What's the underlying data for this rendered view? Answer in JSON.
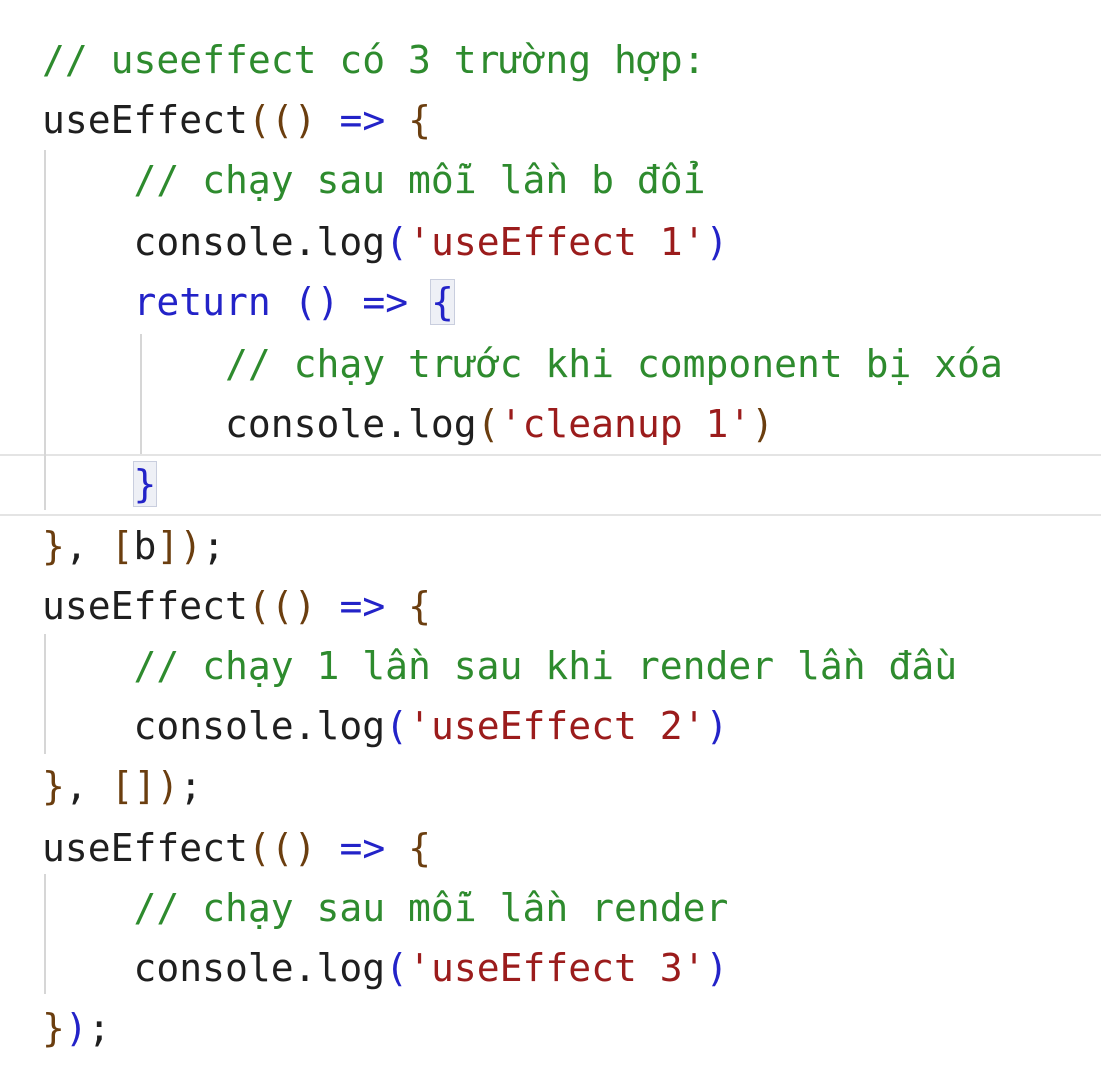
{
  "colors": {
    "comment": "#2e8b2e",
    "keyword": "#2323c8",
    "string": "#9b1c1c",
    "bracket_outer": "#6b3e0f",
    "bracket_mid": "#2323c8",
    "plain": "#1f1f1f",
    "indent_guide": "#d6d6d6",
    "current_line_border": "#e4e4e4"
  },
  "code": {
    "lines": [
      [
        {
          "t": "// useeffect có 3 trường hợp:",
          "c": "comment"
        }
      ],
      [
        {
          "t": "useEffect",
          "c": "plain"
        },
        {
          "t": "(",
          "c": "bracket_outer"
        },
        {
          "t": "()",
          "c": "bracket_outer"
        },
        {
          "t": " ",
          "c": "plain"
        },
        {
          "t": "=>",
          "c": "keyword"
        },
        {
          "t": " ",
          "c": "plain"
        },
        {
          "t": "{",
          "c": "bracket_outer"
        }
      ],
      [
        {
          "t": "    ",
          "c": "plain"
        },
        {
          "t": "// chạy sau mỗi lần b đổi",
          "c": "comment"
        }
      ],
      [
        {
          "t": "    console.log",
          "c": "plain"
        },
        {
          "t": "(",
          "c": "keyword"
        },
        {
          "t": "'useEffect 1'",
          "c": "string"
        },
        {
          "t": ")",
          "c": "keyword"
        }
      ],
      [
        {
          "t": "    ",
          "c": "plain"
        },
        {
          "t": "return",
          "c": "keyword"
        },
        {
          "t": " ",
          "c": "plain"
        },
        {
          "t": "()",
          "c": "keyword"
        },
        {
          "t": " => ",
          "c": "keyword"
        },
        {
          "t": "{",
          "c": "keyword",
          "hl": true
        }
      ],
      [
        {
          "t": "        ",
          "c": "plain"
        },
        {
          "t": "// chạy trước khi component bị xóa",
          "c": "comment"
        }
      ],
      [
        {
          "t": "        console.log",
          "c": "plain"
        },
        {
          "t": "(",
          "c": "bracket_outer"
        },
        {
          "t": "'cleanup 1'",
          "c": "string"
        },
        {
          "t": ")",
          "c": "bracket_outer"
        }
      ],
      [
        {
          "t": "    ",
          "c": "plain"
        },
        {
          "t": "}",
          "c": "keyword",
          "hl": true
        }
      ],
      [
        {
          "t": "}",
          "c": "bracket_outer"
        },
        {
          "t": ", ",
          "c": "plain"
        },
        {
          "t": "[",
          "c": "bracket_outer"
        },
        {
          "t": "b",
          "c": "plain"
        },
        {
          "t": "]",
          "c": "bracket_outer"
        },
        {
          "t": ")",
          "c": "bracket_outer"
        },
        {
          "t": ";",
          "c": "plain"
        }
      ],
      [
        {
          "t": "useEffect",
          "c": "plain"
        },
        {
          "t": "(",
          "c": "bracket_outer"
        },
        {
          "t": "()",
          "c": "bracket_outer"
        },
        {
          "t": " ",
          "c": "plain"
        },
        {
          "t": "=>",
          "c": "keyword"
        },
        {
          "t": " ",
          "c": "plain"
        },
        {
          "t": "{",
          "c": "bracket_outer"
        }
      ],
      [
        {
          "t": "    ",
          "c": "plain"
        },
        {
          "t": "// chạy 1 lần sau khi render lần đầu",
          "c": "comment"
        }
      ],
      [
        {
          "t": "    console.log",
          "c": "plain"
        },
        {
          "t": "(",
          "c": "keyword"
        },
        {
          "t": "'useEffect 2'",
          "c": "string"
        },
        {
          "t": ")",
          "c": "keyword"
        }
      ],
      [
        {
          "t": "}",
          "c": "bracket_outer"
        },
        {
          "t": ", ",
          "c": "plain"
        },
        {
          "t": "[]",
          "c": "bracket_outer"
        },
        {
          "t": ")",
          "c": "bracket_outer"
        },
        {
          "t": ";",
          "c": "plain"
        }
      ],
      [
        {
          "t": "useEffect",
          "c": "plain"
        },
        {
          "t": "(",
          "c": "bracket_outer"
        },
        {
          "t": "()",
          "c": "bracket_outer"
        },
        {
          "t": " ",
          "c": "plain"
        },
        {
          "t": "=>",
          "c": "keyword"
        },
        {
          "t": " ",
          "c": "plain"
        },
        {
          "t": "{",
          "c": "bracket_outer"
        }
      ],
      [
        {
          "t": "    ",
          "c": "plain"
        },
        {
          "t": "// chạy sau mỗi lần render",
          "c": "comment"
        }
      ],
      [
        {
          "t": "    console.log",
          "c": "plain"
        },
        {
          "t": "(",
          "c": "keyword"
        },
        {
          "t": "'useEffect 3'",
          "c": "string"
        },
        {
          "t": ")",
          "c": "keyword"
        }
      ],
      [
        {
          "t": "}",
          "c": "bracket_outer"
        },
        {
          "t": ")",
          "c": "keyword"
        },
        {
          "t": ";",
          "c": "plain"
        }
      ]
    ]
  }
}
